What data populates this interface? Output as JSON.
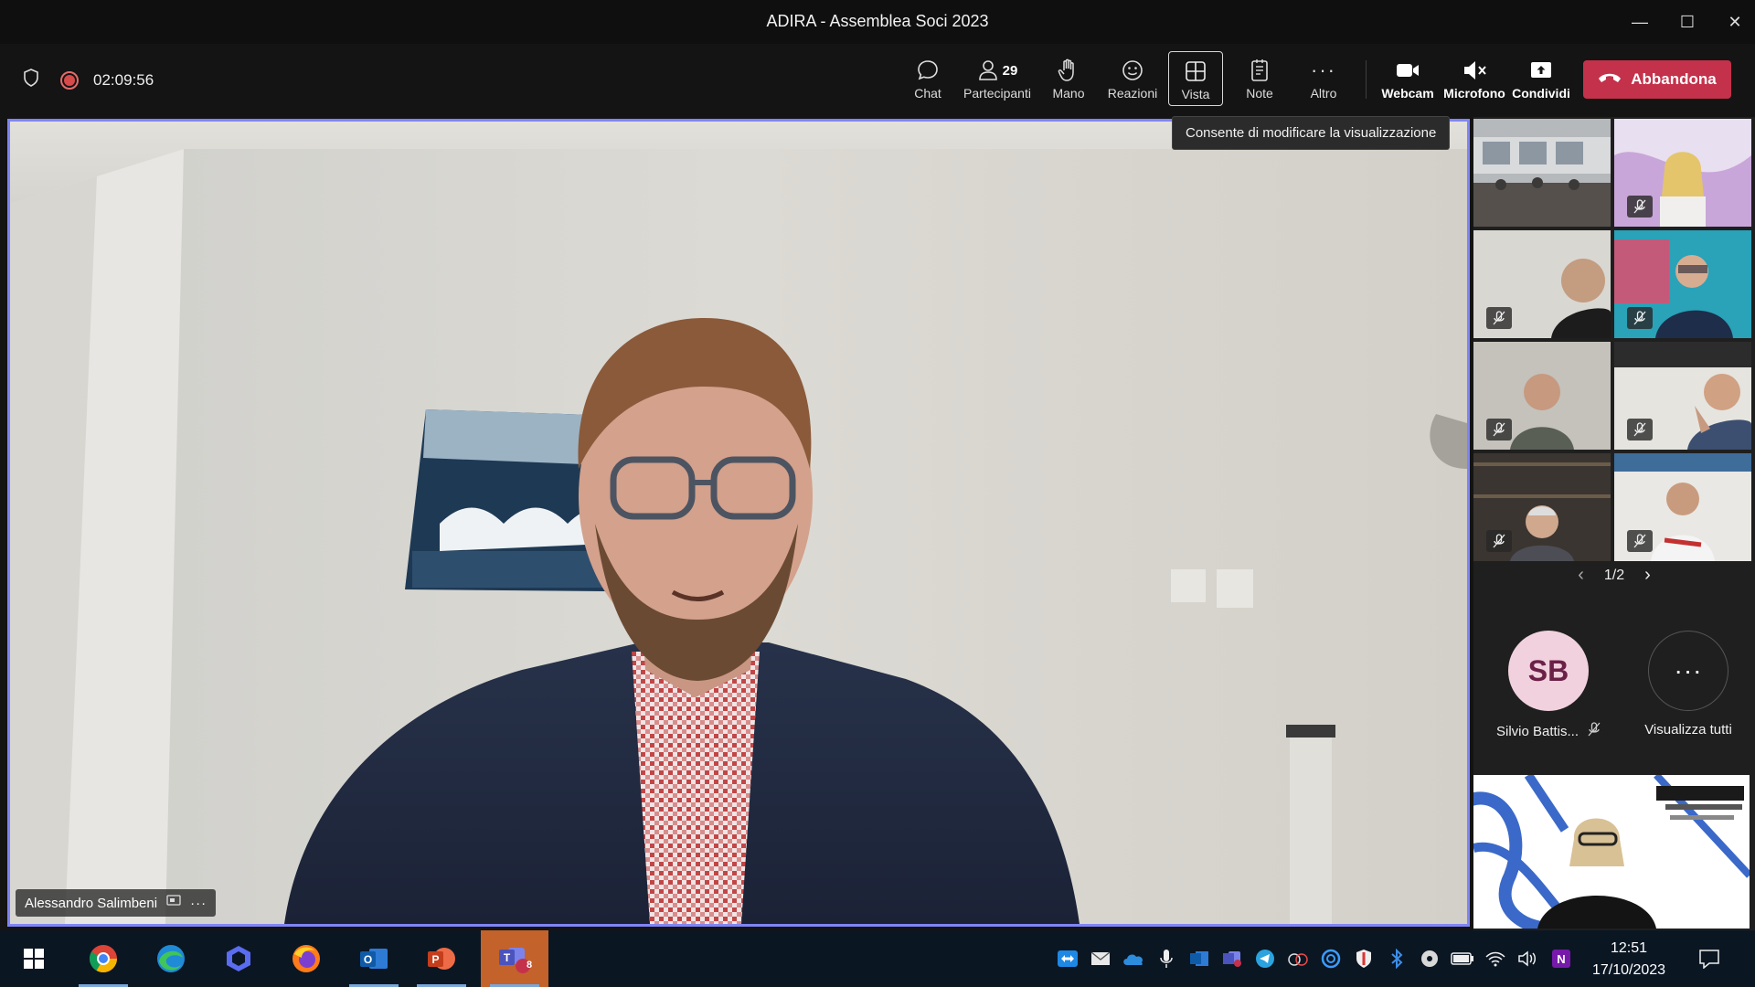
{
  "window": {
    "title": "ADIRA - Assemblea Soci 2023"
  },
  "toolbar": {
    "timer": "02:09:56",
    "chat_label": "Chat",
    "participants_count": "29",
    "participants_label": "Partecipanti",
    "raise_hand_label": "Mano",
    "reactions_label": "Reazioni",
    "view_label": "Vista",
    "notes_label": "Note",
    "more_label": "Altro",
    "webcam_label": "Webcam",
    "mic_label": "Microfono",
    "share_label": "Condividi",
    "leave_label": "Abbandona",
    "leave_color": "#c4314b"
  },
  "tooltip": {
    "text": "Consente di modificare la visualizzazione"
  },
  "main_video": {
    "speaker_name": "Alessandro Salimbeni",
    "highlight_color": "#7f85f5"
  },
  "gallery": {
    "pager": "1/2",
    "more_participants": {
      "initials": "SB",
      "name": "Silvio Battis...",
      "view_all_label": "Visualizza tutti"
    }
  },
  "taskbar": {
    "time": "12:51",
    "date": "17/10/2023",
    "teams_badge": "8",
    "apps": [
      "windows-start",
      "chrome",
      "edge",
      "copilot",
      "firefox",
      "outlook",
      "powerpoint",
      "teams"
    ]
  }
}
